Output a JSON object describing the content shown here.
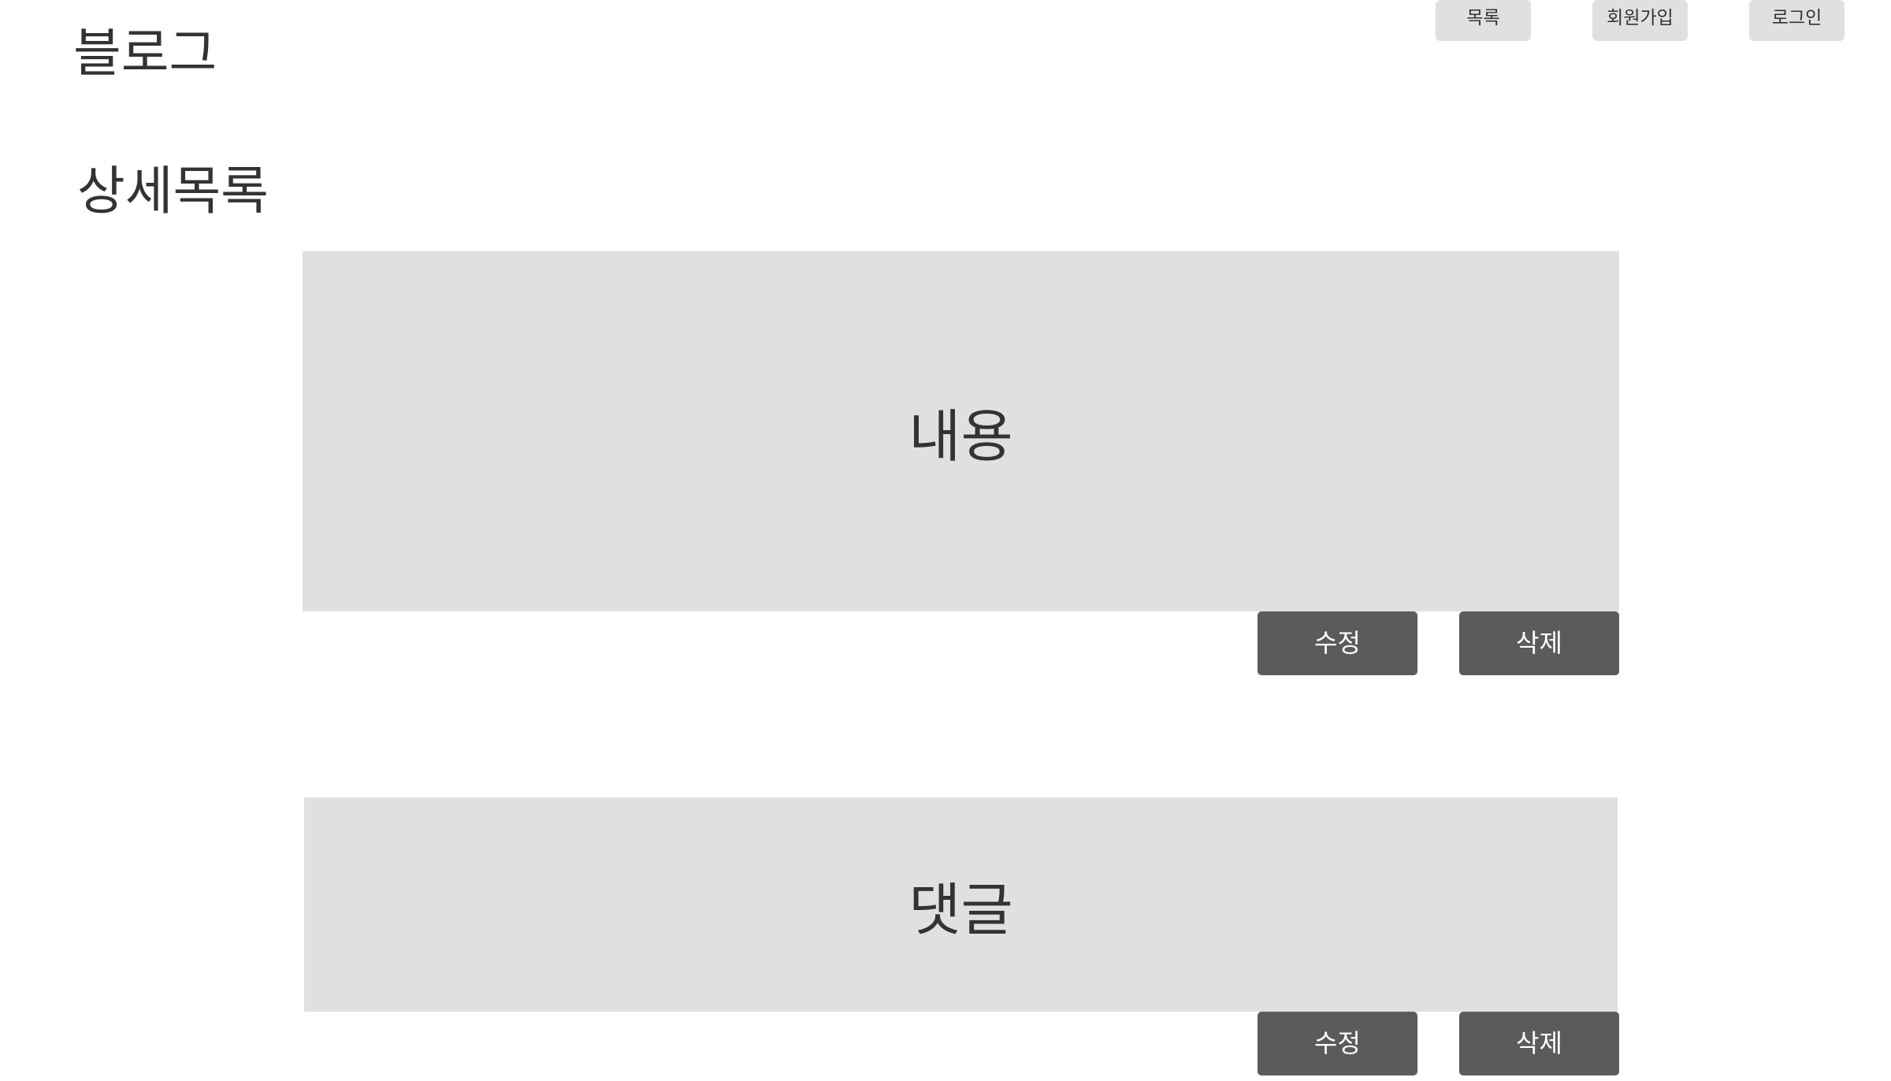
{
  "header": {
    "brand": "블로그",
    "nav": {
      "list_label": "목록",
      "signup_label": "회원가입",
      "login_label": "로그인"
    }
  },
  "main": {
    "title": "상세목록",
    "content_panel": {
      "label": "내용",
      "edit_label": "수정",
      "delete_label": "삭제"
    },
    "comment_panel": {
      "label": "댓글",
      "edit_label": "수정",
      "delete_label": "삭제"
    }
  }
}
